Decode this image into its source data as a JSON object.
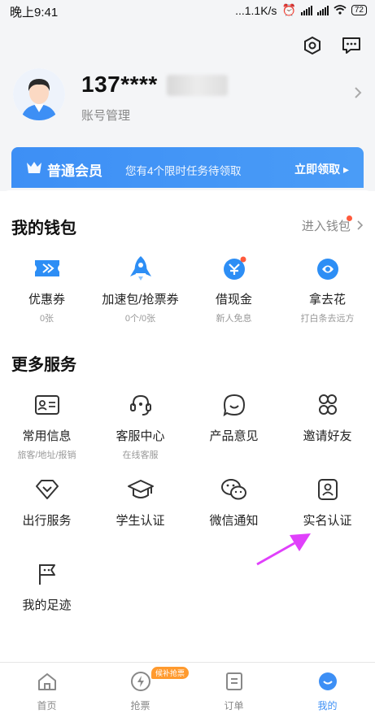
{
  "status_bar": {
    "time": "晚上9:41",
    "speed": "...1.1K/s",
    "battery": "72"
  },
  "profile": {
    "phone": "137****",
    "account_label": "账号管理"
  },
  "member": {
    "level": "普通会员",
    "tip": "您有4个限时任务待领取",
    "claim": "立即领取 ▸"
  },
  "wallet": {
    "title": "我的钱包",
    "enter": "进入钱包",
    "items": [
      {
        "label": "优惠券",
        "sub": "0张",
        "icon": "coupon-icon"
      },
      {
        "label": "加速包/抢票券",
        "sub": "0个/0张",
        "icon": "rocket-icon"
      },
      {
        "label": "借现金",
        "sub": "新人免息",
        "icon": "cash-loan-icon"
      },
      {
        "label": "拿去花",
        "sub": "打白条去远方",
        "icon": "pay-later-icon"
      }
    ]
  },
  "services": {
    "title": "更多服务",
    "items": [
      {
        "label": "常用信息",
        "sub": "旅客/地址/报销",
        "icon": "id-card-icon"
      },
      {
        "label": "客服中心",
        "sub": "在线客服",
        "icon": "headset-icon"
      },
      {
        "label": "产品意见",
        "sub": "",
        "icon": "feedback-icon"
      },
      {
        "label": "邀请好友",
        "sub": "",
        "icon": "invite-icon"
      },
      {
        "label": "出行服务",
        "sub": "",
        "icon": "diamond-icon"
      },
      {
        "label": "学生认证",
        "sub": "",
        "icon": "graduation-cap-icon"
      },
      {
        "label": "微信通知",
        "sub": "",
        "icon": "wechat-icon"
      },
      {
        "label": "实名认证",
        "sub": "",
        "icon": "verified-id-icon"
      },
      {
        "label": "我的足迹",
        "sub": "",
        "icon": "flag-icon"
      }
    ]
  },
  "tabbar": {
    "tag": "候补抢票",
    "tabs": [
      {
        "label": "首页"
      },
      {
        "label": "抢票"
      },
      {
        "label": "订单"
      },
      {
        "label": "我的"
      }
    ]
  },
  "colors": {
    "accent": "#3d8ff5",
    "arrow": "#e040fb",
    "orange": "#ff9a2e"
  }
}
